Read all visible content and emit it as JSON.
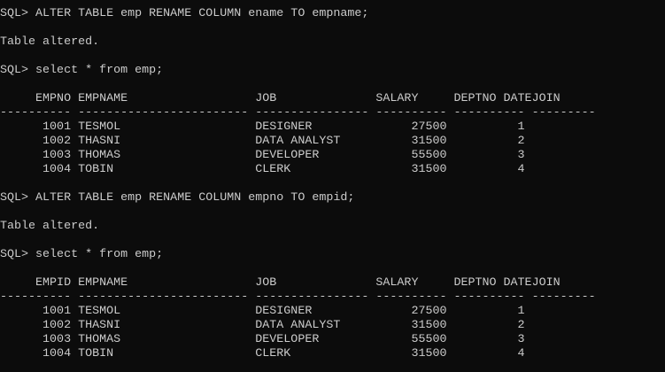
{
  "terminal": {
    "lines": [
      "SQL> ALTER TABLE emp RENAME COLUMN ename TO empname;",
      "",
      "Table altered.",
      "",
      "SQL> select * from emp;",
      "",
      "     EMPNO EMPNAME                  JOB              SALARY     DEPTNO DATEJOIN",
      "---------- ------------------------ ---------------- ---------- ---------- ---------",
      "      1001 TESMOL                   DESIGNER              27500          1",
      "      1002 THASNI                   DATA ANALYST          31500          2",
      "      1003 THOMAS                   DEVELOPER             55500          3",
      "      1004 TOBIN                    CLERK                 31500          4",
      "",
      "SQL> ALTER TABLE emp RENAME COLUMN empno TO empid;",
      "",
      "Table altered.",
      "",
      "SQL> select * from emp;",
      "",
      "     EMPID EMPNAME                  JOB              SALARY     DEPTNO DATEJOIN",
      "---------- ------------------------ ---------------- ---------- ---------- ---------",
      "      1001 TESMOL                   DESIGNER              27500          1",
      "      1002 THASNI                   DATA ANALYST          31500          2",
      "      1003 THOMAS                   DEVELOPER             55500          3",
      "      1004 TOBIN                    CLERK                 31500          4"
    ]
  },
  "colors": {
    "background": "#0c0c0c",
    "text": "#cccccc"
  }
}
